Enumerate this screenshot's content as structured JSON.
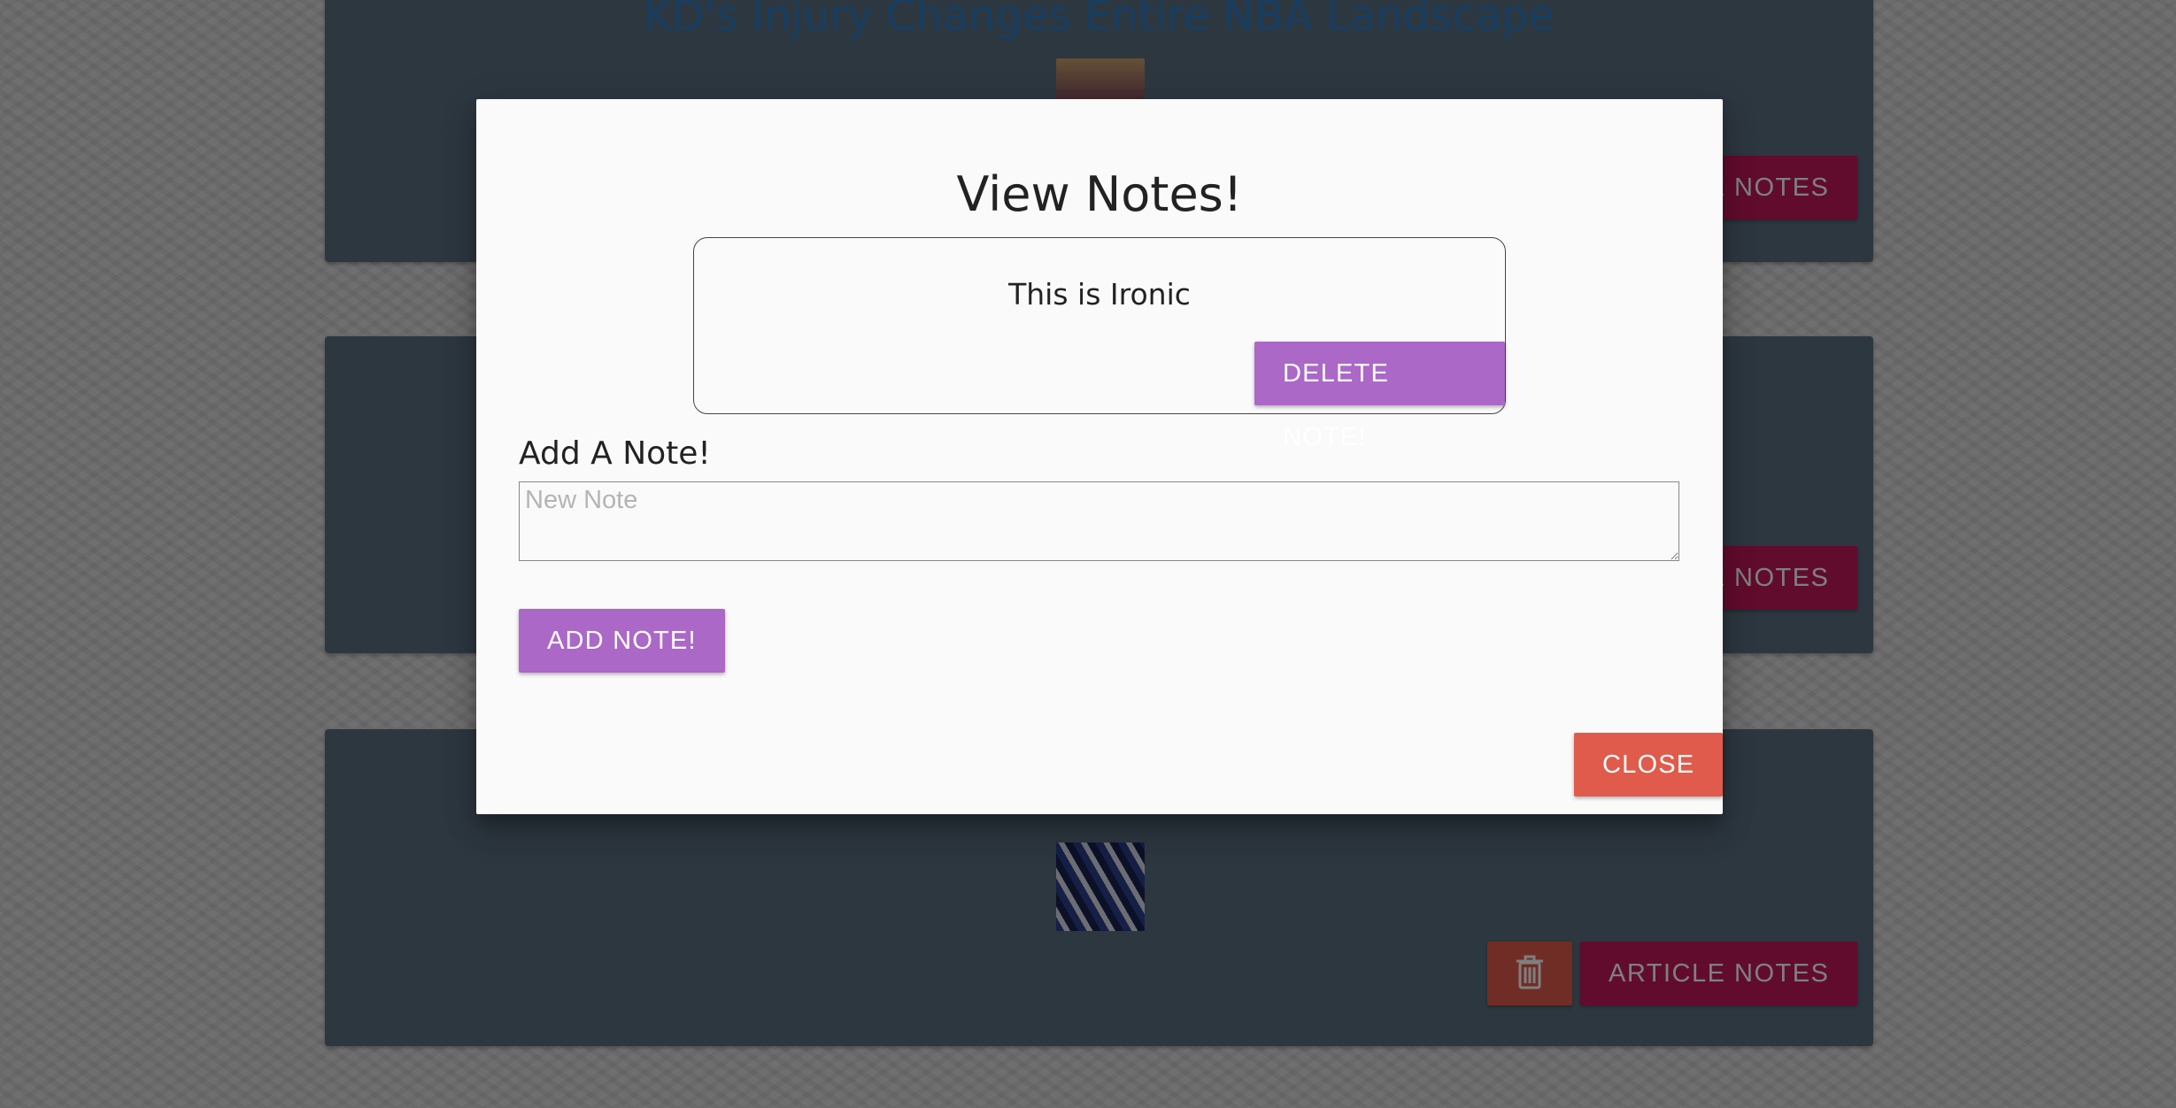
{
  "background": {
    "articles": [
      {
        "title": "KD's Injury Changes Entire NBA Landscape",
        "notes_label": "ARTICLE NOTES"
      },
      {
        "title": "",
        "notes_label": "ARTICLE NOTES"
      },
      {
        "title": "",
        "notes_label": "ARTICLE NOTES",
        "delete_icon": "trash-icon"
      }
    ]
  },
  "modal": {
    "title": "View Notes!",
    "notes": [
      {
        "text": "This is Ironic",
        "delete_label": "DELETE NOTE!"
      }
    ],
    "add_label": "Add A Note!",
    "input_placeholder": "New Note",
    "input_value": "",
    "add_button_label": "ADD NOTE!",
    "close_label": "CLOSE"
  },
  "colors": {
    "purple_button": "#ab68c7",
    "close_button": "#e05b4b",
    "notes_button": "#c2185b",
    "card": "#5b6f80",
    "title_link": "#2e7dc2"
  }
}
